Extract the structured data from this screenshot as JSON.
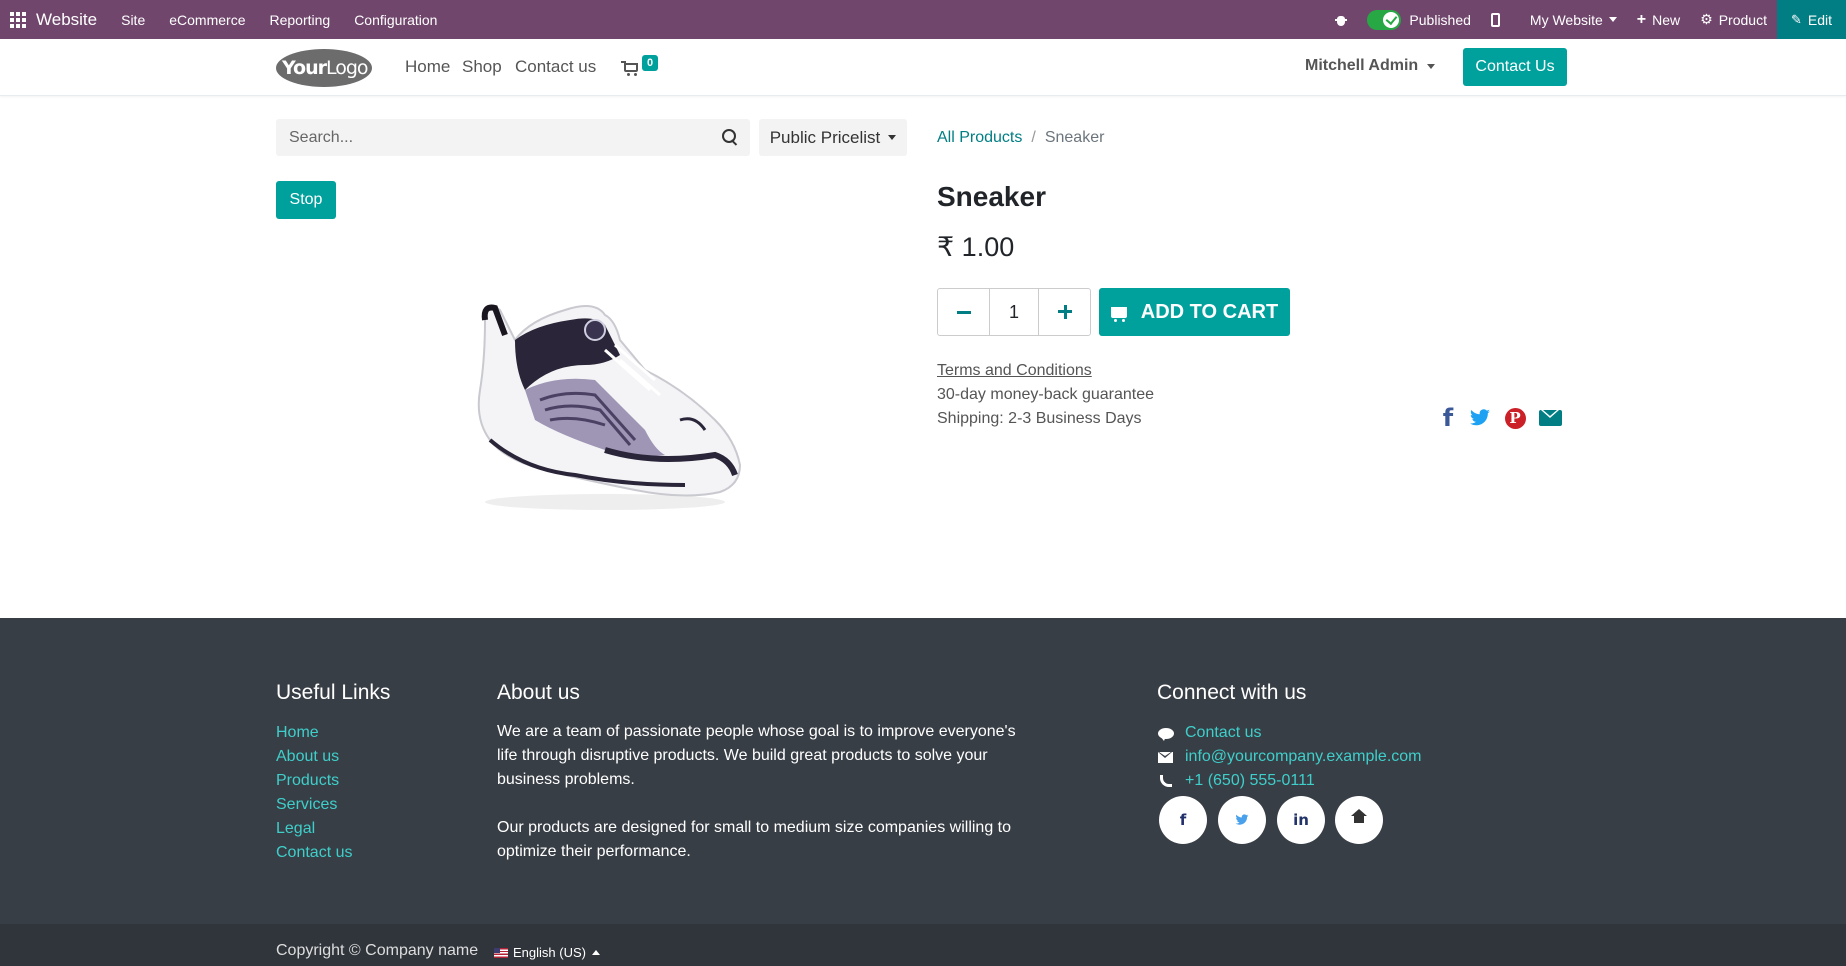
{
  "admin_bar": {
    "brand": "Website",
    "menu": [
      "Site",
      "eCommerce",
      "Reporting",
      "Configuration"
    ],
    "published_label": "Published",
    "website_label": "My Website",
    "new_label": "New",
    "product_label": "Product",
    "edit_label": "Edit"
  },
  "header": {
    "logo_text_bold": "Your",
    "logo_text": "Logo",
    "nav": [
      "Home",
      "Shop",
      "Contact us"
    ],
    "cart_count": "0",
    "user": "Mitchell Admin",
    "contact_button": "Contact Us"
  },
  "product_page": {
    "search_placeholder": "Search...",
    "pricelist": "Public Pricelist",
    "breadcrumb": {
      "parent": "All Products",
      "current": "Sneaker"
    },
    "stop_button": "Stop",
    "title": "Sneaker",
    "price": "₹ 1.00",
    "quantity": "1",
    "add_to_cart": "ADD TO CART",
    "terms": "Terms and Conditions",
    "guarantee": "30-day money-back guarantee",
    "shipping": "Shipping: 2-3 Business Days",
    "share_icons": [
      "facebook-icon",
      "twitter-icon",
      "pinterest-icon",
      "envelope-icon"
    ]
  },
  "footer": {
    "useful_links": {
      "title": "Useful Links",
      "links": [
        "Home",
        "About us",
        "Products",
        "Services",
        "Legal",
        "Contact us"
      ]
    },
    "about": {
      "title": "About us",
      "p1_lines": [
        "We are a team of passionate people whose goal is to improve everyone's",
        "life through disruptive products. We build great products to solve your",
        "business problems."
      ],
      "p2_lines": [
        "Our products are designed for small to medium size companies willing to",
        "optimize their performance."
      ]
    },
    "connect": {
      "title": "Connect with us",
      "contact": "Contact us",
      "email": "info@yourcompany.example.com",
      "phone": "+1 (650) 555-0111",
      "social": [
        "f",
        "in"
      ]
    },
    "copyright": "Copyright © Company name",
    "language": "English (US)"
  },
  "colors": {
    "admin_bar": "#71466d",
    "primary": "#00a09d",
    "link": "#017e84",
    "footer_bg": "#383e45",
    "footer_link": "#3ecfcb"
  }
}
